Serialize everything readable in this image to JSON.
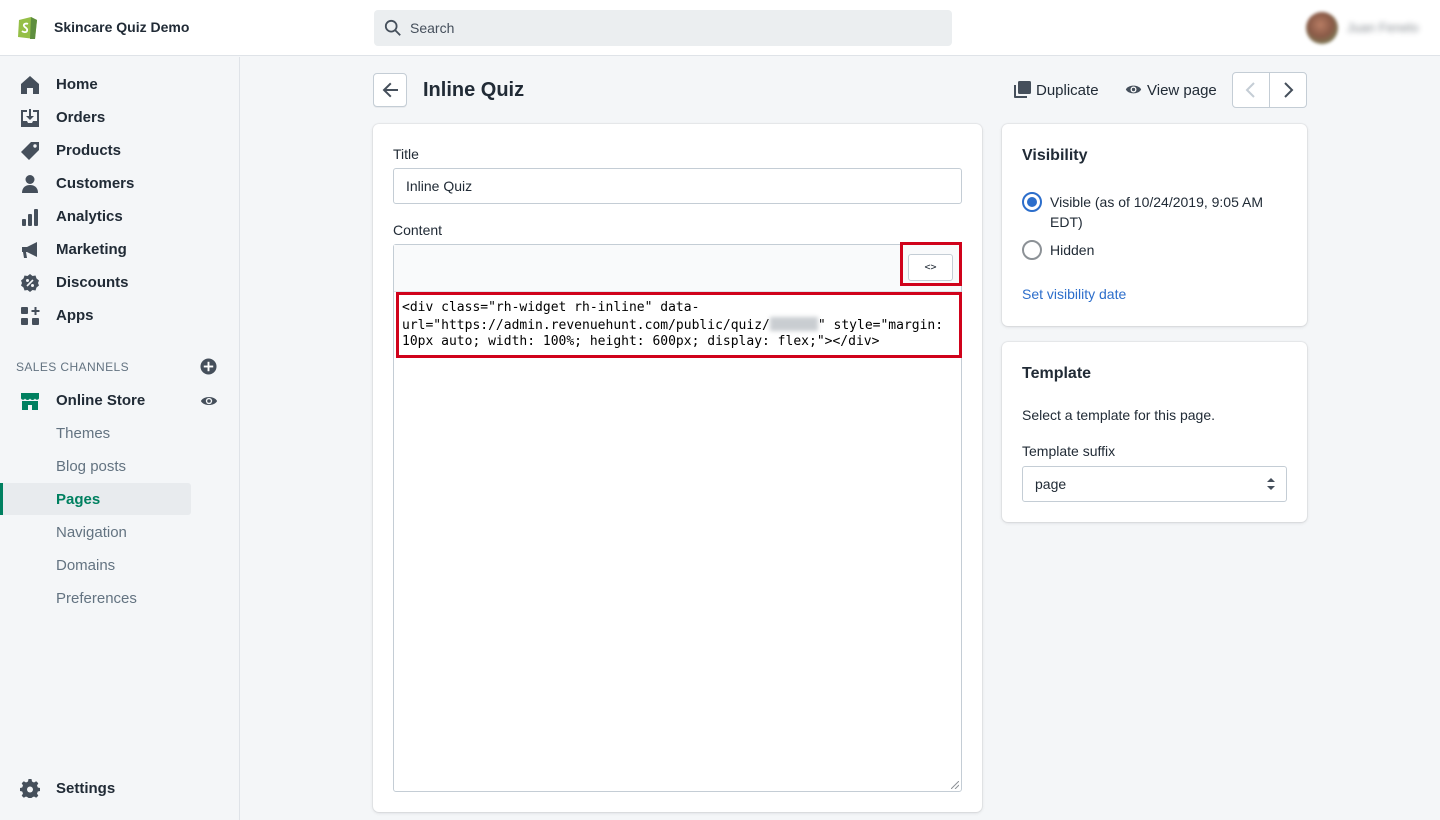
{
  "topbar": {
    "store_name": "Skincare Quiz Demo",
    "search_placeholder": "Search",
    "user_name": "Juan Fenelo"
  },
  "sidebar": {
    "items": [
      {
        "label": "Home",
        "icon": "home-icon"
      },
      {
        "label": "Orders",
        "icon": "orders-icon"
      },
      {
        "label": "Products",
        "icon": "tag-icon"
      },
      {
        "label": "Customers",
        "icon": "person-icon"
      },
      {
        "label": "Analytics",
        "icon": "bar-chart-icon"
      },
      {
        "label": "Marketing",
        "icon": "megaphone-icon"
      },
      {
        "label": "Discounts",
        "icon": "discount-icon"
      },
      {
        "label": "Apps",
        "icon": "apps-icon"
      }
    ],
    "sales_channels_title": "SALES CHANNELS",
    "online_store": "Online Store",
    "sub_items": [
      "Themes",
      "Blog posts",
      "Pages",
      "Navigation",
      "Domains",
      "Preferences"
    ],
    "active_sub_item": "Pages",
    "settings": "Settings"
  },
  "header": {
    "title": "Inline Quiz",
    "duplicate": "Duplicate",
    "view_page": "View page"
  },
  "main": {
    "title_label": "Title",
    "title_value": "Inline Quiz",
    "content_label": "Content",
    "code_button": "<>",
    "code_line_1": "<div class=\"rh-widget rh-inline\" data-",
    "code_line_2a": "url=\"https://admin.revenuehunt.com/public/quiz/",
    "code_line_2b": "\" style=\"margin:",
    "code_line_3": "10px auto; width: 100%; height: 600px; display: flex;\"></div>"
  },
  "visibility": {
    "title": "Visibility",
    "visible_label": "Visible (as of 10/24/2019, 9:05 AM EDT)",
    "hidden_label": "Hidden",
    "selected": "Visible",
    "set_date_link": "Set visibility date"
  },
  "template": {
    "title": "Template",
    "description": "Select a template for this page.",
    "suffix_label": "Template suffix",
    "suffix_value": "page"
  },
  "colors": {
    "accent_green": "#008060",
    "link_blue": "#2c6ecb",
    "highlight_red": "#d0021b"
  }
}
